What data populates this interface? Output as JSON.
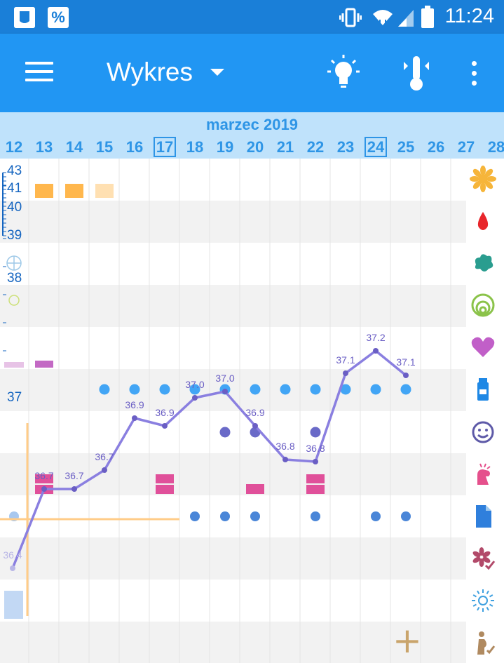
{
  "status_bar": {
    "time": "11:24",
    "percent_icon": "%",
    "icons": [
      "app-notification-icon",
      "percent-icon",
      "vibrate-icon",
      "wifi-icon",
      "signal-icon",
      "battery-icon"
    ]
  },
  "app_bar": {
    "title": "Wykres",
    "icons": [
      "menu-icon",
      "dropdown-caret-icon",
      "lightbulb-icon",
      "thermometer-icon",
      "more-vert-icon"
    ]
  },
  "month": "marzec 2019",
  "days": [
    {
      "label": "12",
      "boxed": false
    },
    {
      "label": "13",
      "boxed": false
    },
    {
      "label": "14",
      "boxed": false
    },
    {
      "label": "15",
      "boxed": false
    },
    {
      "label": "16",
      "boxed": false
    },
    {
      "label": "17",
      "boxed": true
    },
    {
      "label": "18",
      "boxed": false
    },
    {
      "label": "19",
      "boxed": false
    },
    {
      "label": "20",
      "boxed": false
    },
    {
      "label": "21",
      "boxed": false
    },
    {
      "label": "22",
      "boxed": false
    },
    {
      "label": "23",
      "boxed": false
    },
    {
      "label": "24",
      "boxed": true
    },
    {
      "label": "25",
      "boxed": false
    },
    {
      "label": "26",
      "boxed": false
    },
    {
      "label": "27",
      "boxed": false
    },
    {
      "label": "28",
      "boxed": false
    }
  ],
  "y_labels": [
    "43",
    "41",
    "40",
    "39",
    "38",
    "37"
  ],
  "colors": {
    "accent": "#2196f3",
    "status_bar": "#1a7fd8",
    "day_header": "#2e95e6",
    "temp_line": "#8a7fe0",
    "temp_label": "#6a5ec4",
    "dot_blue": "#42a5f5",
    "dot_navy": "#6a6ac8",
    "dot_mid": "#4a86d8",
    "bar_pink": "#e0509a",
    "bar_orange": "#ffb74d",
    "bar_orange_light": "#ffe0b2",
    "plus": "#c9a46b"
  },
  "chart_data": {
    "type": "line",
    "title": "",
    "x": [
      "12",
      "13",
      "14",
      "15",
      "16",
      "17",
      "18",
      "19",
      "20",
      "21",
      "22",
      "23",
      "24",
      "25"
    ],
    "series": [
      {
        "values": [
          36.4,
          36.7,
          36.7,
          36.7,
          36.9,
          36.9,
          37.0,
          37.0,
          36.9,
          36.8,
          36.8,
          37.1,
          37.2,
          37.1
        ],
        "point_labels": [
          "36.4",
          "36.7",
          "36.7",
          "36.7",
          "36.9",
          "36.9",
          "37.0",
          "37.0",
          "36.9",
          "36.8",
          "36.8",
          "37.1",
          "37.2",
          "37.1"
        ]
      }
    ],
    "ylim": [
      36.3,
      43
    ],
    "markers": {
      "orange_squares_row1": [
        "13",
        "14"
      ],
      "light_orange_square_row1": [
        "15"
      ],
      "purple_bar_row5": [
        "13"
      ],
      "blue_dots_row6": [
        "15",
        "16",
        "17",
        "18",
        "19",
        "20",
        "21",
        "22",
        "23",
        "24",
        "25"
      ],
      "navy_dots_row7": [
        "19",
        "20",
        "22"
      ],
      "pink_double_bars_row8": [
        "13",
        "17",
        "22"
      ],
      "pink_single_bar_row8": [
        "20"
      ],
      "blue_dots_row9": [
        "18",
        "19",
        "20",
        "22",
        "24",
        "25"
      ]
    }
  },
  "side_icons": [
    "flower-icon",
    "blood-drop-icon",
    "splash-icon",
    "circles-icon",
    "heart-icon",
    "bottle-icon",
    "smiley-icon",
    "hand-icon",
    "document-icon",
    "flower-check-icon",
    "sparkle-icon",
    "pregnancy-check-icon"
  ],
  "add_button": "+"
}
